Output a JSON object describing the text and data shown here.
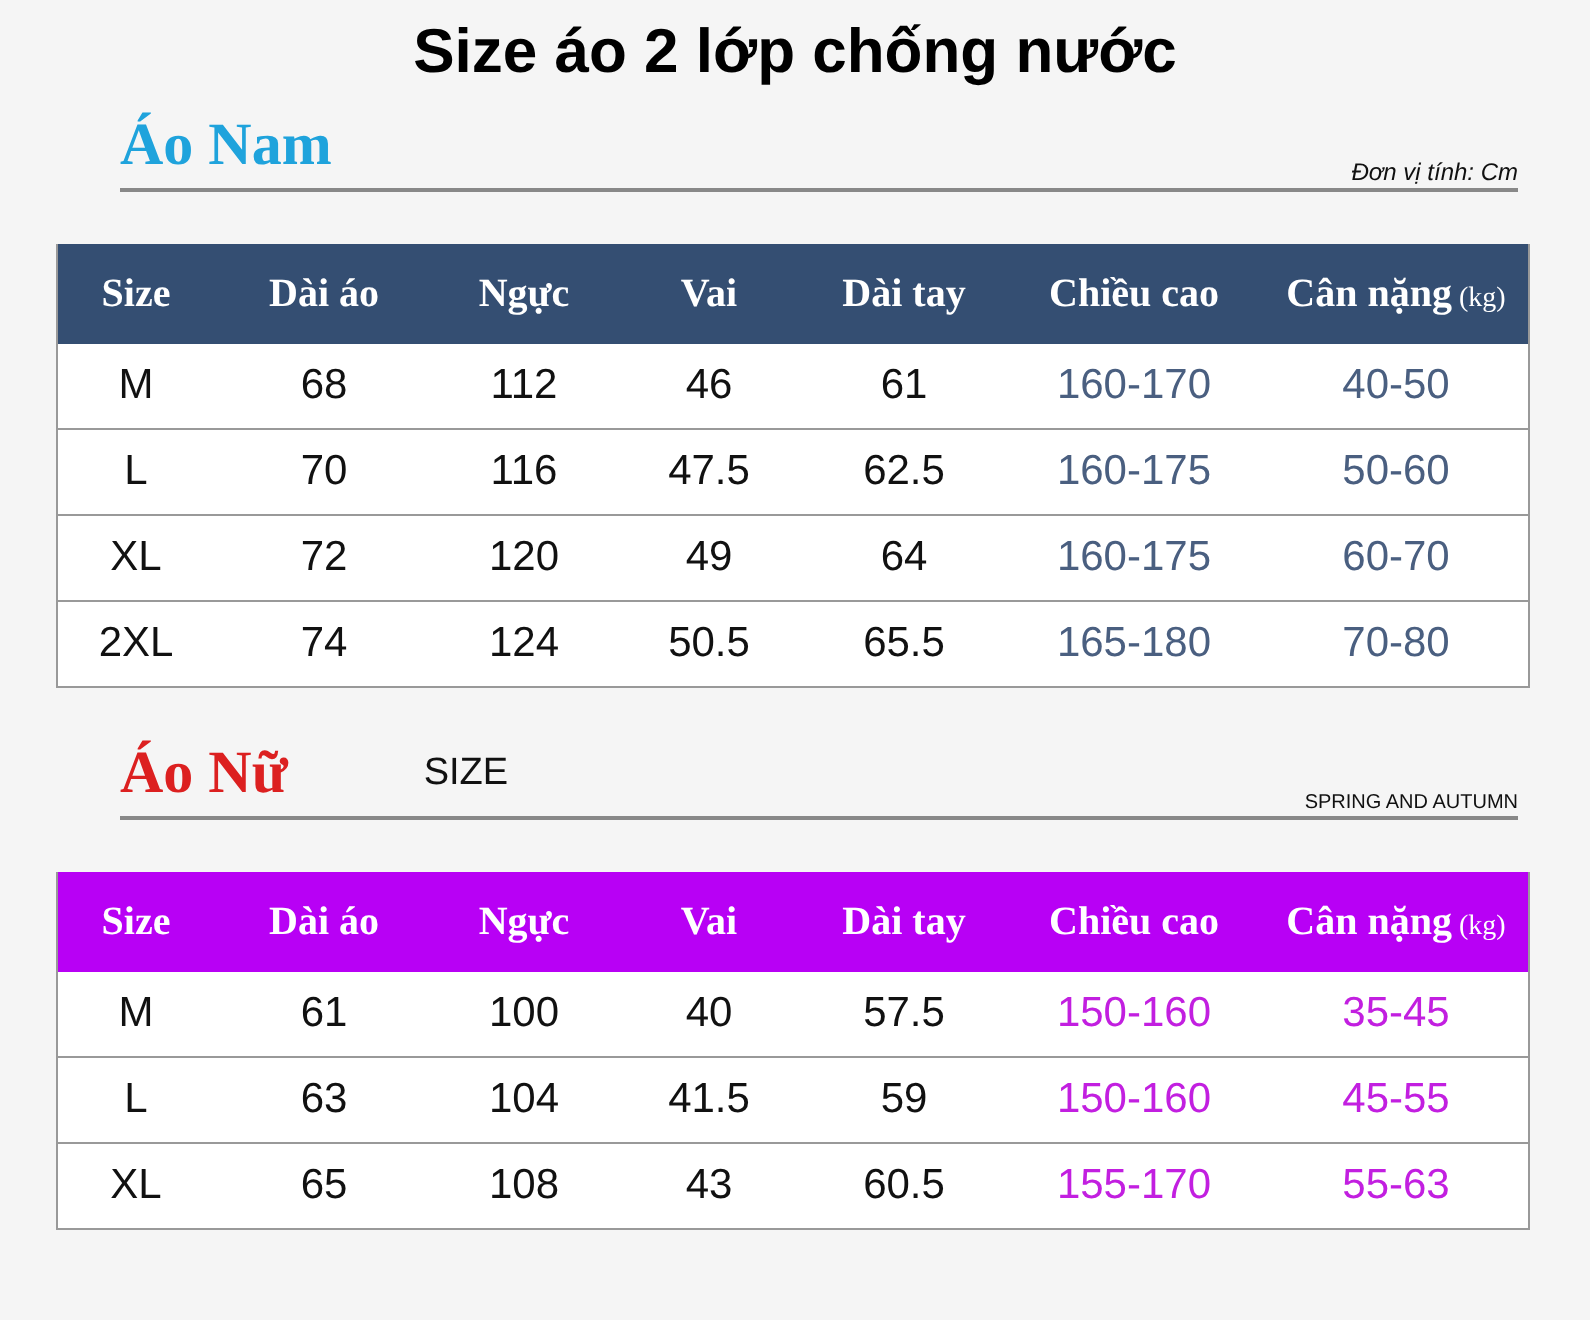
{
  "title": "Size áo 2 lớp chống nước",
  "sections": [
    {
      "kind": "men",
      "heading": "Áo Nam",
      "note": "Đơn vị tính: Cm",
      "columns": [
        {
          "label": "Size"
        },
        {
          "label": "Dài áo"
        },
        {
          "label": "Ngực"
        },
        {
          "label": "Vai"
        },
        {
          "label": "Dài tay"
        },
        {
          "label": "Chiều cao"
        },
        {
          "label": "Cân nặng",
          "unit": "(kg)"
        }
      ],
      "rows": [
        [
          "M",
          "68",
          "112",
          "46",
          "61",
          "160-170",
          "40-50"
        ],
        [
          "L",
          "70",
          "116",
          "47.5",
          "62.5",
          "160-175",
          "50-60"
        ],
        [
          "XL",
          "72",
          "120",
          "49",
          "64",
          "160-175",
          "60-70"
        ],
        [
          "2XL",
          "74",
          "124",
          "50.5",
          "65.5",
          "165-180",
          "70-80"
        ]
      ]
    },
    {
      "kind": "women",
      "heading": "Áo Nữ",
      "subheading": "SIZE",
      "note": "SPRING AND AUTUMN",
      "columns": [
        {
          "label": "Size"
        },
        {
          "label": "Dài áo"
        },
        {
          "label": "Ngực"
        },
        {
          "label": "Vai"
        },
        {
          "label": "Dài tay"
        },
        {
          "label": "Chiều cao"
        },
        {
          "label": "Cân nặng",
          "unit": "(kg)"
        }
      ],
      "rows": [
        [
          "M",
          "61",
          "100",
          "40",
          "57.5",
          "150-160",
          "35-45"
        ],
        [
          "L",
          "63",
          "104",
          "41.5",
          "59",
          "150-160",
          "45-55"
        ],
        [
          "XL",
          "65",
          "108",
          "43",
          "60.5",
          "155-170",
          "55-63"
        ]
      ]
    }
  ]
}
